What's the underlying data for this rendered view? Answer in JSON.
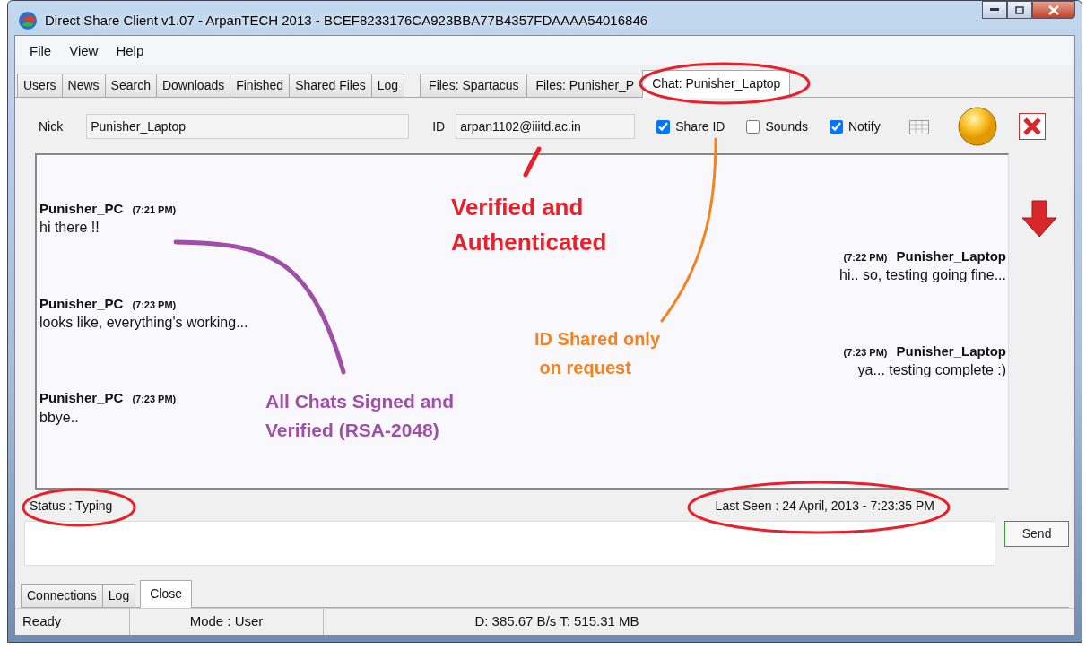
{
  "window": {
    "title": "Direct Share Client v1.07 - ArpanTECH 2013 - BCEF8233176CA923BBA77B4357FDAAAA54016846"
  },
  "menu": [
    "File",
    "View",
    "Help"
  ],
  "tabs": [
    {
      "label": "Users",
      "selected": false
    },
    {
      "label": "News",
      "selected": false
    },
    {
      "label": "Search",
      "selected": false
    },
    {
      "label": "Downloads",
      "selected": false
    },
    {
      "label": "Finished",
      "selected": false
    },
    {
      "label": "Shared Files",
      "selected": false
    },
    {
      "label": "Log",
      "selected": false
    },
    {
      "label": "Files: Spartacus",
      "selected": false
    },
    {
      "label": "Files: Punisher_P",
      "selected": false
    },
    {
      "label": "Chat: Punisher_Laptop",
      "selected": true
    }
  ],
  "chat_header": {
    "nick_label": "Nick",
    "nick": "Punisher_Laptop",
    "id_label": "ID",
    "id": "arpan1102@iiitd.ac.in",
    "options": [
      {
        "label": "Share ID",
        "checked": true
      },
      {
        "label": "Sounds",
        "checked": false
      },
      {
        "label": "Notify",
        "checked": true
      }
    ]
  },
  "messages": [
    {
      "kind": "received",
      "author": "Punisher_PC",
      "time": "(7:21 PM)",
      "text": "hi there !!"
    },
    {
      "kind": "sent",
      "author": "Punisher_Laptop",
      "time": "(7:22 PM)",
      "text": "hi.. so, testing going fine..."
    },
    {
      "kind": "received",
      "author": "Punisher_PC",
      "time": "(7:23 PM)",
      "text": "looks like, everything's working..."
    },
    {
      "kind": "sent",
      "author": "Punisher_Laptop",
      "time": "(7:23 PM)",
      "text": "ya... testing complete :)"
    },
    {
      "kind": "received",
      "author": "Punisher_PC",
      "time": "(7:23 PM)",
      "text": "bbye.."
    }
  ],
  "status": "Status : Typing",
  "last_seen": "Last Seen : 24 April, 2013 - 7:23:35 PM",
  "send_button": "Send",
  "bottom_tabs": [
    {
      "label": "Connections",
      "selected": false
    },
    {
      "label": "Log",
      "selected": false
    },
    {
      "label": "Close",
      "selected": true
    }
  ],
  "status_bar": [
    "Ready",
    "Mode : User",
    "D: 385.67 B/s T: 515.31 MB"
  ],
  "annotations": [
    {
      "text": "Verified and\nAuthenticated",
      "color": "#e8202a"
    },
    {
      "text": "ID Shared only\n on request",
      "color": "#f58220"
    },
    {
      "text": "All Chats Signed and\nVerified (RSA-2048)",
      "color": "#a04fa8"
    }
  ]
}
